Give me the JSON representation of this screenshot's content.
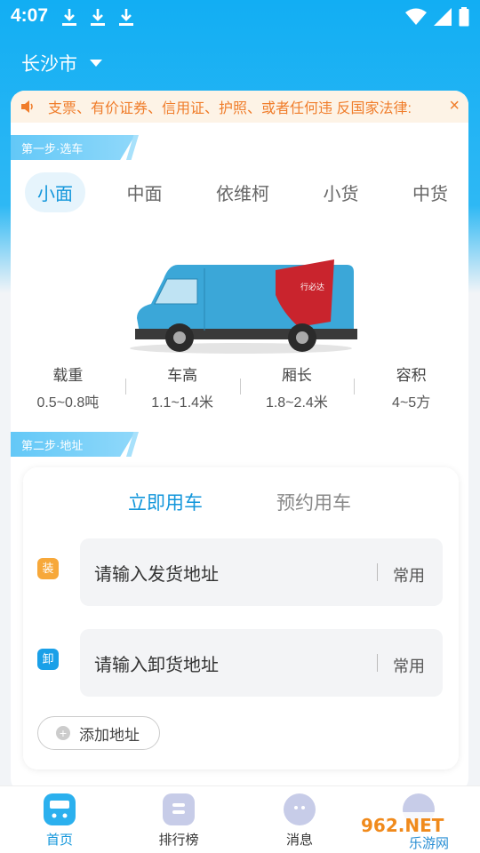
{
  "status_bar": {
    "time": "4:07"
  },
  "header": {
    "city": "长沙市"
  },
  "notice": {
    "text": "支票、有价证券、信用证、护照、或者任何违 反国家法律:",
    "close": "×"
  },
  "step1": {
    "label": "第一步·选车"
  },
  "vehicle_tabs": [
    {
      "label": "小面",
      "active": true
    },
    {
      "label": "中面",
      "active": false
    },
    {
      "label": "依维柯",
      "active": false
    },
    {
      "label": "小货",
      "active": false
    },
    {
      "label": "中货",
      "active": false
    }
  ],
  "van_logo": "行必达",
  "specs": [
    {
      "label": "载重",
      "value": "0.5~0.8吨"
    },
    {
      "label": "车高",
      "value": "1.1~1.4米"
    },
    {
      "label": "厢长",
      "value": "1.8~2.4米"
    },
    {
      "label": "容积",
      "value": "4~5方"
    }
  ],
  "step2": {
    "label": "第二步·地址"
  },
  "modes": {
    "now": "立即用车",
    "reserve": "预约用车"
  },
  "address": {
    "load_tag": "装",
    "load_placeholder": "请输入发货地址",
    "unload_tag": "卸",
    "unload_placeholder": "请输入卸货地址",
    "common": "常用",
    "add": "添加地址"
  },
  "tabbar": [
    {
      "label": "首页",
      "active": true
    },
    {
      "label": "排行榜",
      "active": false
    },
    {
      "label": "消息",
      "active": false
    }
  ],
  "watermark": {
    "brand": "962.NET",
    "sub": "乐游网"
  },
  "colors": {
    "primary": "#1296db",
    "notice": "#f07d2b",
    "load_tag": "#f7a83a",
    "unload_tag": "#1aa0e8"
  }
}
